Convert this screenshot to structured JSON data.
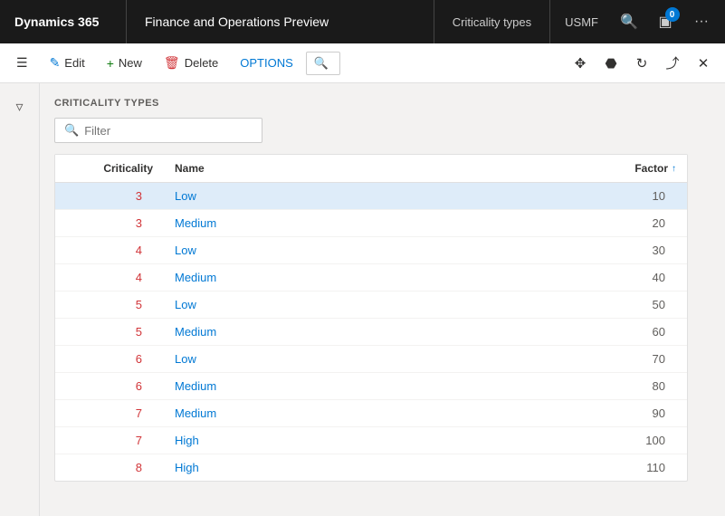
{
  "topbar": {
    "brand": "Dynamics 365",
    "app": "Finance and Operations Preview",
    "page": "Criticality types",
    "company": "USMF"
  },
  "actionbar": {
    "edit": "Edit",
    "new": "New",
    "delete": "Delete",
    "options": "OPTIONS"
  },
  "section": {
    "title": "CRITICALITY TYPES",
    "filter_placeholder": "Filter"
  },
  "table": {
    "columns": [
      {
        "key": "criticality",
        "label": "Criticality"
      },
      {
        "key": "name",
        "label": "Name"
      },
      {
        "key": "factor",
        "label": "Factor",
        "sorted": "asc"
      }
    ],
    "rows": [
      {
        "criticality": "3",
        "name": "Low",
        "factor": "10",
        "selected": true
      },
      {
        "criticality": "3",
        "name": "Medium",
        "factor": "20",
        "selected": false
      },
      {
        "criticality": "4",
        "name": "Low",
        "factor": "30",
        "selected": false
      },
      {
        "criticality": "4",
        "name": "Medium",
        "factor": "40",
        "selected": false
      },
      {
        "criticality": "5",
        "name": "Low",
        "factor": "50",
        "selected": false
      },
      {
        "criticality": "5",
        "name": "Medium",
        "factor": "60",
        "selected": false
      },
      {
        "criticality": "6",
        "name": "Low",
        "factor": "70",
        "selected": false
      },
      {
        "criticality": "6",
        "name": "Medium",
        "factor": "80",
        "selected": false
      },
      {
        "criticality": "7",
        "name": "Medium",
        "factor": "90",
        "selected": false
      },
      {
        "criticality": "7",
        "name": "High",
        "factor": "100",
        "selected": false
      },
      {
        "criticality": "8",
        "name": "High",
        "factor": "110",
        "selected": false
      }
    ]
  },
  "icons": {
    "search": "🔍",
    "edit": "✏",
    "new": "+",
    "delete": "🗑",
    "filter": "🔍",
    "hamburger": "≡",
    "funnel": "⊿",
    "grid": "⊞",
    "office": "⬡",
    "notif_count": "0",
    "refresh": "↻",
    "popout": "⤢",
    "close": "✕",
    "dots": "···",
    "bell": "🔔",
    "up_arrow": "↑"
  }
}
